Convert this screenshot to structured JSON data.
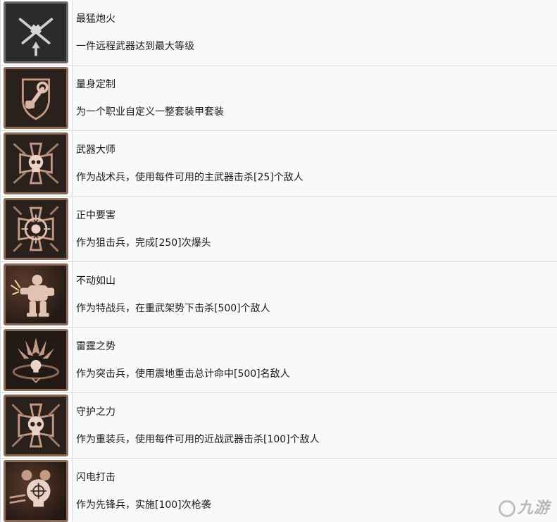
{
  "achievements": [
    {
      "title": "最猛炮火",
      "desc": "一件远程武器达到最大等级",
      "icon": "crossed-guns-icon"
    },
    {
      "title": "量身定制",
      "desc": "为一个职业自定义一整套装甲套装",
      "icon": "wrench-shield-icon"
    },
    {
      "title": "武器大师",
      "desc": "作为战术兵，使用每件可用的主武器击杀[25]个敌人",
      "icon": "skull-cross-weapons-icon"
    },
    {
      "title": "正中要害",
      "desc": "作为狙击兵，完成[250]次爆头",
      "icon": "crosshair-skull-icon"
    },
    {
      "title": "不动如山",
      "desc": "作为特战兵，在重武架势下击杀[500]个敌人",
      "icon": "heavy-marine-icon"
    },
    {
      "title": "雷霆之势",
      "desc": "作为突击兵，使用震地重击总计命中[500]名敌人",
      "icon": "ground-slam-skull-icon"
    },
    {
      "title": "守护之力",
      "desc": "作为重装兵，使用每件可用的近战武器击杀[100]个敌人",
      "icon": "skull-cross-melee-icon"
    },
    {
      "title": "闪电打击",
      "desc": "作为先锋兵，实施[100]次枪袭",
      "icon": "skull-target-icon"
    }
  ],
  "watermark": "九游"
}
